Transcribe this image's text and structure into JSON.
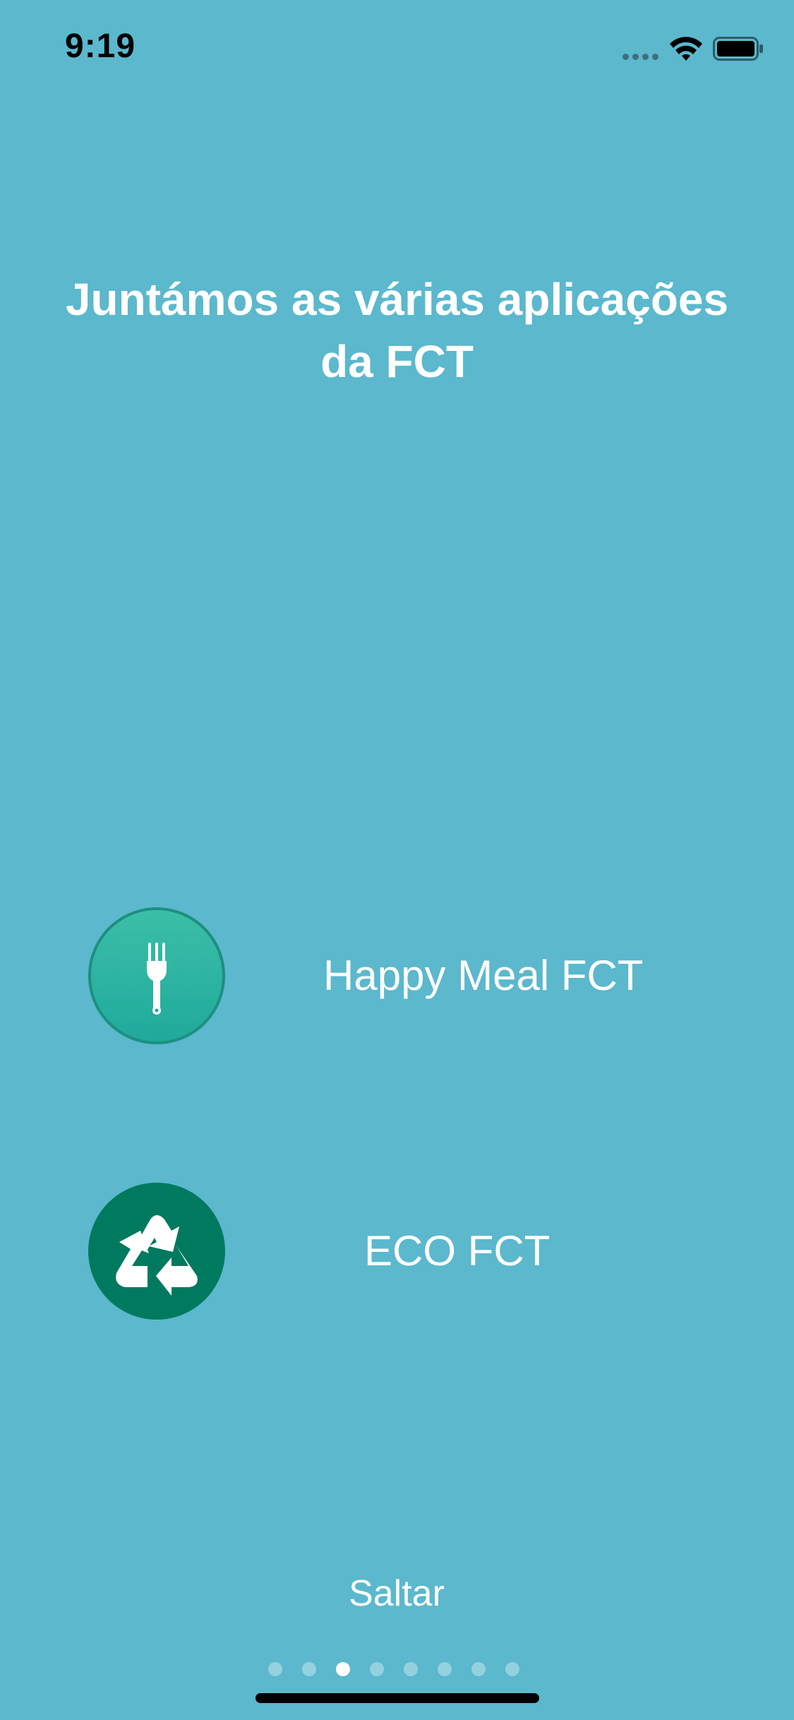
{
  "status_bar": {
    "time": "9:19",
    "wifi_icon": "wifi-icon",
    "battery_icon": "battery-icon"
  },
  "onboarding": {
    "title": "Juntámos as várias aplicações da FCT",
    "apps": [
      {
        "label": "Happy Meal FCT",
        "icon": "fork-icon",
        "color": "#1fa99b"
      },
      {
        "label": "ECO FCT",
        "icon": "recycle-icon",
        "color": "#007a5e"
      }
    ],
    "skip_label": "Saltar",
    "pagination": {
      "total": 8,
      "current": 3
    }
  },
  "colors": {
    "background": "#5bb8cd",
    "text": "#ffffff",
    "active_dot": "#ffffff"
  }
}
